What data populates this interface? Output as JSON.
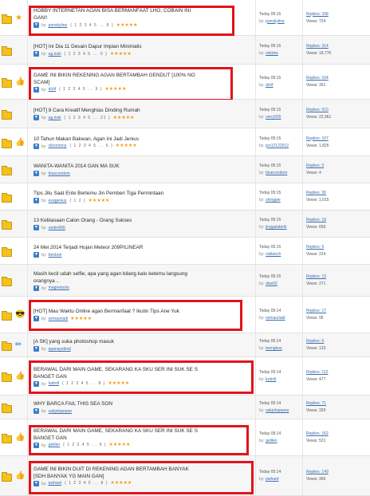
{
  "threads": [
    {
      "title_lines": [
        "HOBBY INTERNETAN AGAN BISA BERMANFAAT LHO, COBAIN INI",
        "GAN!!"
      ],
      "author": "ponskyline",
      "pages": "1 2 3 4 5 ... 8",
      "stars": "★★★★★",
      "time": "Today 05:15",
      "last_by": "by:",
      "last_user": "ponskyline",
      "replies_label": "Replies:",
      "replies": "158",
      "views_label": "Views:",
      "views": "724",
      "emoji": "★",
      "highlight": true
    },
    {
      "title_lines": [
        "[HOT] Ini Dia 11 Desain Dapur Impian Minimalis"
      ],
      "author": "ag.riski",
      "pages": "1 2 3 4 5 ... 6",
      "stars": "★★★★★",
      "time": "Today 05:15",
      "last_by": "by:",
      "last_user": "riskirke",
      "replies_label": "Replies:",
      "replies": "314",
      "views_label": "Views:",
      "views": "18,776",
      "emoji": "",
      "highlight": false
    },
    {
      "title_lines": [
        "GAME INI BIKIN REKENING AGAN BERTAMBAH GENDUT [100% NO",
        "SCAM]"
      ],
      "author": "dchf",
      "pages": "1 2 3 4 5 ... 9",
      "stars": "★★★★★",
      "time": "Today 05:15",
      "last_by": "by:",
      "last_user": "dchf",
      "replies_label": "Replies:",
      "replies": "164",
      "views_label": "Views:",
      "views": "361",
      "emoji": "👍",
      "highlight": true
    },
    {
      "title_lines": [
        "[HOT] 8 Cara Kreatif Menghias Dinding Rumah"
      ],
      "author": "ag.riski",
      "pages": "1 2 3 4 5 ... 21",
      "stars": "★★★★★",
      "time": "Today 05:15",
      "last_by": "by:",
      "last_user": "verry555",
      "replies_label": "Replies:",
      "replies": "510",
      "views_label": "Views:",
      "views": "22,961",
      "emoji": "",
      "highlight": false
    },
    {
      "title_lines": [
        "10 Tahun Makan Bakwan, Agan Ini Jadi Jenius"
      ],
      "author": "cikoromoy",
      "pages": "1 2 3 4 5 ... 6",
      "stars": "★★★★★",
      "time": "Today 05:15",
      "last_by": "by:",
      "last_user": "jon12122012",
      "replies_label": "Replies:",
      "replies": "107",
      "views_label": "Views:",
      "views": "1,825",
      "emoji": "👍",
      "highlight": false
    },
    {
      "title_lines": [
        "WANITA-WANITA 2014 GAN MA SUK"
      ],
      "author": "bluecondom",
      "pages": "",
      "stars": "",
      "time": "Today 05:15",
      "last_by": "by:",
      "last_user": "bluecondom",
      "replies_label": "Replies:",
      "replies": "0",
      "views_label": "Views:",
      "views": "4",
      "emoji": "",
      "highlight": false
    },
    {
      "title_lines": [
        "Tips Jitu Saat Ente Bertemu Jin Pemberi Tiga Permintaan"
      ],
      "author": "evagenius",
      "pages": "1 2",
      "stars": "★★★★★",
      "time": "Today 05:15",
      "last_by": "by:",
      "last_user": "shingpie",
      "replies_label": "Replies:",
      "replies": "36",
      "views_label": "Views:",
      "views": "1,015",
      "emoji": "",
      "highlight": false
    },
    {
      "title_lines": [
        "13 Kebiasaan Calon Orang - Orang Sukses"
      ],
      "author": "under666",
      "pages": "",
      "stars": "",
      "time": "Today 05:15",
      "last_by": "by:",
      "last_user": "jinggalabirik",
      "replies_label": "Replies:",
      "replies": "18",
      "views_label": "Views:",
      "views": "656",
      "emoji": "",
      "highlight": false
    },
    {
      "title_lines": [
        "24 Mei 2014 Terjadi Hujan Meteor 209P/LINEAR"
      ],
      "author": "beebrel",
      "pages": "",
      "stars": "",
      "time": "Today 05:15",
      "last_by": "by:",
      "last_user": "robbiech",
      "replies_label": "Replies:",
      "replies": "6",
      "views_label": "Views:",
      "views": "224",
      "emoji": "",
      "highlight": false
    },
    {
      "title_lines": [
        "Masih kecil udah selfie, apa yang agan bilang kalo ketemu langsung",
        "orangnya .."
      ],
      "author": "magnetoolo",
      "pages": "",
      "stars": "",
      "time": "Today 05:15",
      "last_by": "by:",
      "last_user": "dias92",
      "replies_label": "Replies:",
      "replies": "13",
      "views_label": "Views:",
      "views": "271",
      "emoji": "",
      "highlight": false
    },
    {
      "title_lines": [
        "[HOT] Mau Waktu Online agan Bermanfaat ? Ikutin Tips Ane Yuk"
      ],
      "author": "semauriadi",
      "pages": "",
      "stars": "★★★★★",
      "time": "Today 05:14",
      "last_by": "by:",
      "last_user": "semauriadi",
      "replies_label": "Replies:",
      "replies": "17",
      "views_label": "Views:",
      "views": "95",
      "emoji": "😎",
      "highlight": true
    },
    {
      "title_lines": [
        "[A SK] yang suka photoshop masuk"
      ],
      "author": "apanayelindi",
      "pages": "",
      "stars": "",
      "time": "Today 05:14",
      "last_by": "by:",
      "last_user": "teengkuu",
      "replies_label": "Replies:",
      "replies": "6",
      "views_label": "Views:",
      "views": "133",
      "emoji": "✏",
      "highlight": false
    },
    {
      "title_lines": [
        "BERAWAL DARI MAIN GAME, SEKARANG KA SKU SER INI SUK SE S",
        "BANGET GAN"
      ],
      "author": "ludroll",
      "pages": "1 2 3 4 5 ... 8",
      "stars": "★★★★★",
      "time": "Today 05:14",
      "last_by": "by:",
      "last_user": "ludroll",
      "replies_label": "Replies:",
      "replies": "112",
      "views_label": "Views:",
      "views": "477",
      "emoji": "👍",
      "highlight": true
    },
    {
      "title_lines": [
        "WHY BARCA FAIL THIS SEA SON"
      ],
      "author": "sakjolopepee",
      "pages": "",
      "stars": "",
      "time": "Today 05:14",
      "last_by": "by:",
      "last_user": "sakjolopepee",
      "replies_label": "Replies:",
      "replies": "71",
      "views_label": "Views:",
      "views": "320",
      "emoji": "",
      "highlight": false
    },
    {
      "title_lines": [
        "BERAWAL DARI MAIN GAME, SEKARANG KA SKU SER INI SUK SE S",
        "BANGET GAN"
      ],
      "author": "gelilen",
      "pages": "1 2 3 4 5 ... 9",
      "stars": "★★★★★",
      "time": "Today 05:14",
      "last_by": "by:",
      "last_user": "gelilen",
      "replies_label": "Replies:",
      "replies": "162",
      "views_label": "Views:",
      "views": "521",
      "emoji": "👍",
      "highlight": true
    },
    {
      "title_lines": [
        "GAME INI BIKIN DUIT DI REKENING AGAN BERTAMBAH BANYAK",
        "[SDH BANYAK YG MAIN GAN]"
      ],
      "author": "pwhard",
      "pages": "1 2 3 4 5 ... 8",
      "stars": "★★★★★",
      "time": "Today 05:14",
      "last_by": "by:",
      "last_user": "pwhard",
      "replies_label": "Replies:",
      "replies": "149",
      "views_label": "Views:",
      "views": "366",
      "emoji": "👍",
      "highlight": true
    }
  ]
}
